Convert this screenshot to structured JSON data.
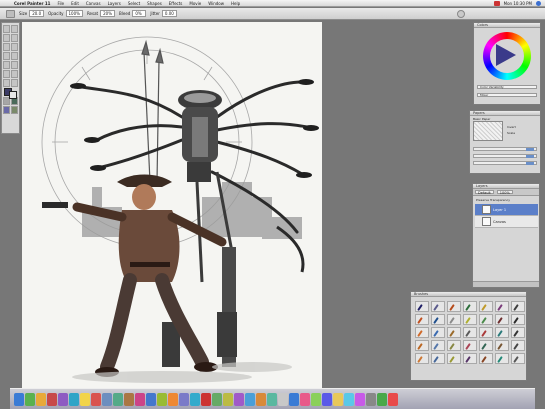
{
  "menubar": {
    "apple": "",
    "items": [
      "Corel Painter 11",
      "File",
      "Edit",
      "Canvas",
      "Layers",
      "Select",
      "Shapes",
      "Effects",
      "Movie",
      "Window",
      "Help"
    ],
    "clock": "Mon 10:30 PM"
  },
  "propbar": {
    "size_label": "Size",
    "size_value": "20.0",
    "opacity_label": "Opacity",
    "opacity_value": "100%",
    "resat_label": "Resat",
    "resat_value": "20%",
    "bleed_label": "Bleed",
    "bleed_value": "0%",
    "jitter_label": "Jitter",
    "jitter_value": "0.00"
  },
  "color_panel": {
    "title": "Colors",
    "slider_1": "Color Variability",
    "slider_2": "Mixer"
  },
  "paper_panel": {
    "title": "Papers",
    "paper_name": "Basic Paper",
    "option_1": "Invert",
    "option_2": "Scale"
  },
  "layers_panel": {
    "title": "Layers",
    "mode": "Default",
    "opacity": "100%",
    "preserve": "Preserve Transparency",
    "pick_up": "Pick Up Underlying Color",
    "layers": [
      {
        "name": "Layer 1"
      },
      {
        "name": "Canvas"
      }
    ]
  },
  "brush_panel": {
    "title": "Brushes",
    "tip_colors": [
      "#1e1e66",
      "#5a5a8c",
      "#b54a1a",
      "#2c6e3a",
      "#c09a2a",
      "#7a3b7a",
      "#3c3c3c",
      "#c05020",
      "#1e4e8c",
      "#8a8a8a",
      "#b0b030",
      "#4a8a4a",
      "#6e2e2e",
      "#2a2a2a",
      "#d06a2a",
      "#3a6ab0",
      "#9a6a2a",
      "#5a5a5a",
      "#aa3a3a",
      "#2a7a7a",
      "#333333",
      "#bb6622",
      "#5577aa",
      "#888844",
      "#aa4455",
      "#336655",
      "#775533",
      "#444444",
      "#cc7733",
      "#446699",
      "#999933",
      "#553366",
      "#884422",
      "#228877",
      "#555555"
    ]
  },
  "dock": {
    "icon_colors": [
      "#3a7bd5",
      "#5ab14f",
      "#e8a93a",
      "#c74949",
      "#8e5bc2",
      "#2fa4c7",
      "#f2d44a",
      "#d9534f",
      "#6c8ebf",
      "#55aa88",
      "#aa7744",
      "#cc4488",
      "#4477cc",
      "#99bb33",
      "#ee8833",
      "#7a7ac8",
      "#33aacc",
      "#cc3333",
      "#66aa66",
      "#bbbb44",
      "#a05ac8",
      "#4a9fd8",
      "#d88a3a",
      "#5ab8a0",
      "#c8c8c8",
      "#3a7bd5",
      "#e85a8a",
      "#8ad05a",
      "#5a5ae8",
      "#e8c85a",
      "#5ac8e8",
      "#c85ae8",
      "#888888",
      "#4aa84a",
      "#e84a4a"
    ]
  }
}
